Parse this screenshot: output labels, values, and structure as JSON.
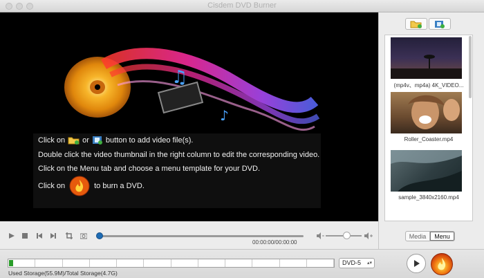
{
  "window": {
    "title": "Cisdem DVD Burner"
  },
  "preview": {
    "hints": [
      {
        "before": "Click on",
        "or": "or",
        "after": "button to add video file(s)."
      },
      "Double click the video thumbnail in the right column to edit the corresponding video.",
      "Click on the Menu tab and choose a menu template for your DVD.",
      {
        "before": "Click on",
        "after": "to burn a DVD."
      }
    ]
  },
  "player": {
    "time": "00:00:00/00:00:00",
    "progress": 0,
    "volume": 0.6
  },
  "sidebar": {
    "add_folder_icon": "add-folder-icon",
    "add_video_icon": "add-video-icon",
    "videos": [
      {
        "name": "(mp4v、mp4a) 4K_VIDEO..."
      },
      {
        "name": "Roller_Coaster.mp4"
      },
      {
        "name": "sample_3840x2160.mp4"
      }
    ],
    "tabs": [
      {
        "label": "Media",
        "selected": false
      },
      {
        "label": "Menu",
        "selected": true
      }
    ]
  },
  "storage": {
    "label": "Used Storage(55.9M)/Total Storage(4.7G)",
    "used_fraction": 0.012,
    "disc_type": "DVD-5"
  },
  "colors": {
    "fill": "#2a9d2a",
    "accent": "#1e6cb4",
    "burn": "#f07a12"
  }
}
